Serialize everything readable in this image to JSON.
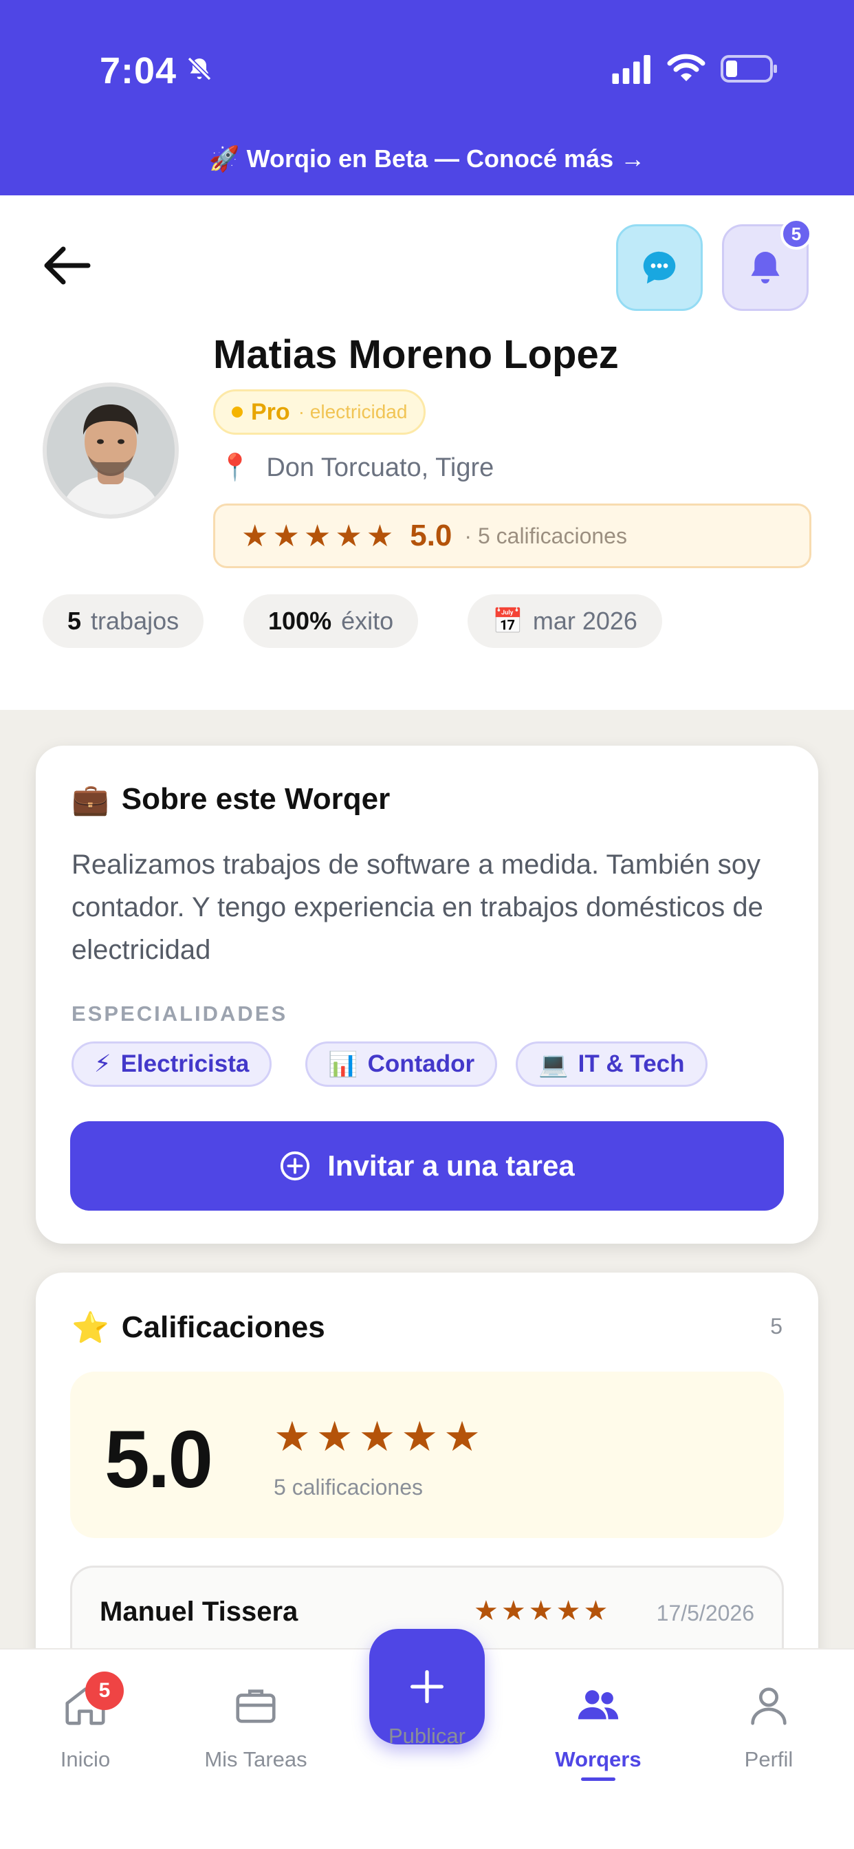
{
  "status_bar": {
    "time": "7:04"
  },
  "banner": {
    "text": "🚀 Worqio en Beta — Conocé más →"
  },
  "header": {
    "notification_count": "5"
  },
  "profile": {
    "name": "Matias Moreno Lopez",
    "level": "Pro",
    "category": "· electricidad",
    "location_icon": "📍",
    "location": "Don Torcuato, Tigre",
    "stars": "★★★★★",
    "rating": "5.0",
    "rating_count": "· 5 calificaciones",
    "stats": [
      {
        "value": "5",
        "label": "trabajos"
      },
      {
        "value": "100%",
        "label": "éxito"
      },
      {
        "icon": "📅",
        "label": "mar 2026"
      }
    ]
  },
  "about": {
    "icon": "💼",
    "title": "Sobre este Worqer",
    "text": "Realizamos trabajos de software a medida. También soy contador. Y tengo experiencia en trabajos domésticos de electricidad",
    "specialties_heading": "ESPECIALIDADES",
    "specialties": [
      {
        "icon": "⚡",
        "label": "Electricista"
      },
      {
        "icon": "📊",
        "label": "Contador"
      },
      {
        "icon": "💻",
        "label": "IT & Tech"
      }
    ],
    "invite_label": "Invitar a una tarea"
  },
  "ratings": {
    "icon": "⭐",
    "title": "Calificaciones",
    "count": "5",
    "score": "5.0",
    "stars": "★★★★★",
    "count_text": "5 calificaciones",
    "reviews": [
      {
        "name": "Manuel Tissera",
        "stars": "★★★★★",
        "date": "17/5/2026"
      }
    ]
  },
  "nav": {
    "items": [
      {
        "label": "Inicio",
        "icon": "home-icon",
        "badge": "5"
      },
      {
        "label": "Mis Tareas",
        "icon": "briefcase-icon"
      },
      {
        "label": "Publicar",
        "icon": "plus-icon"
      },
      {
        "label": "Worqers",
        "icon": "users-icon",
        "active": true
      },
      {
        "label": "Perfil",
        "icon": "user-icon"
      }
    ]
  },
  "colors": {
    "primary": "#4f46e5",
    "star": "#b4530a",
    "pro": "#e7a500",
    "badge_red": "#ef4444"
  }
}
